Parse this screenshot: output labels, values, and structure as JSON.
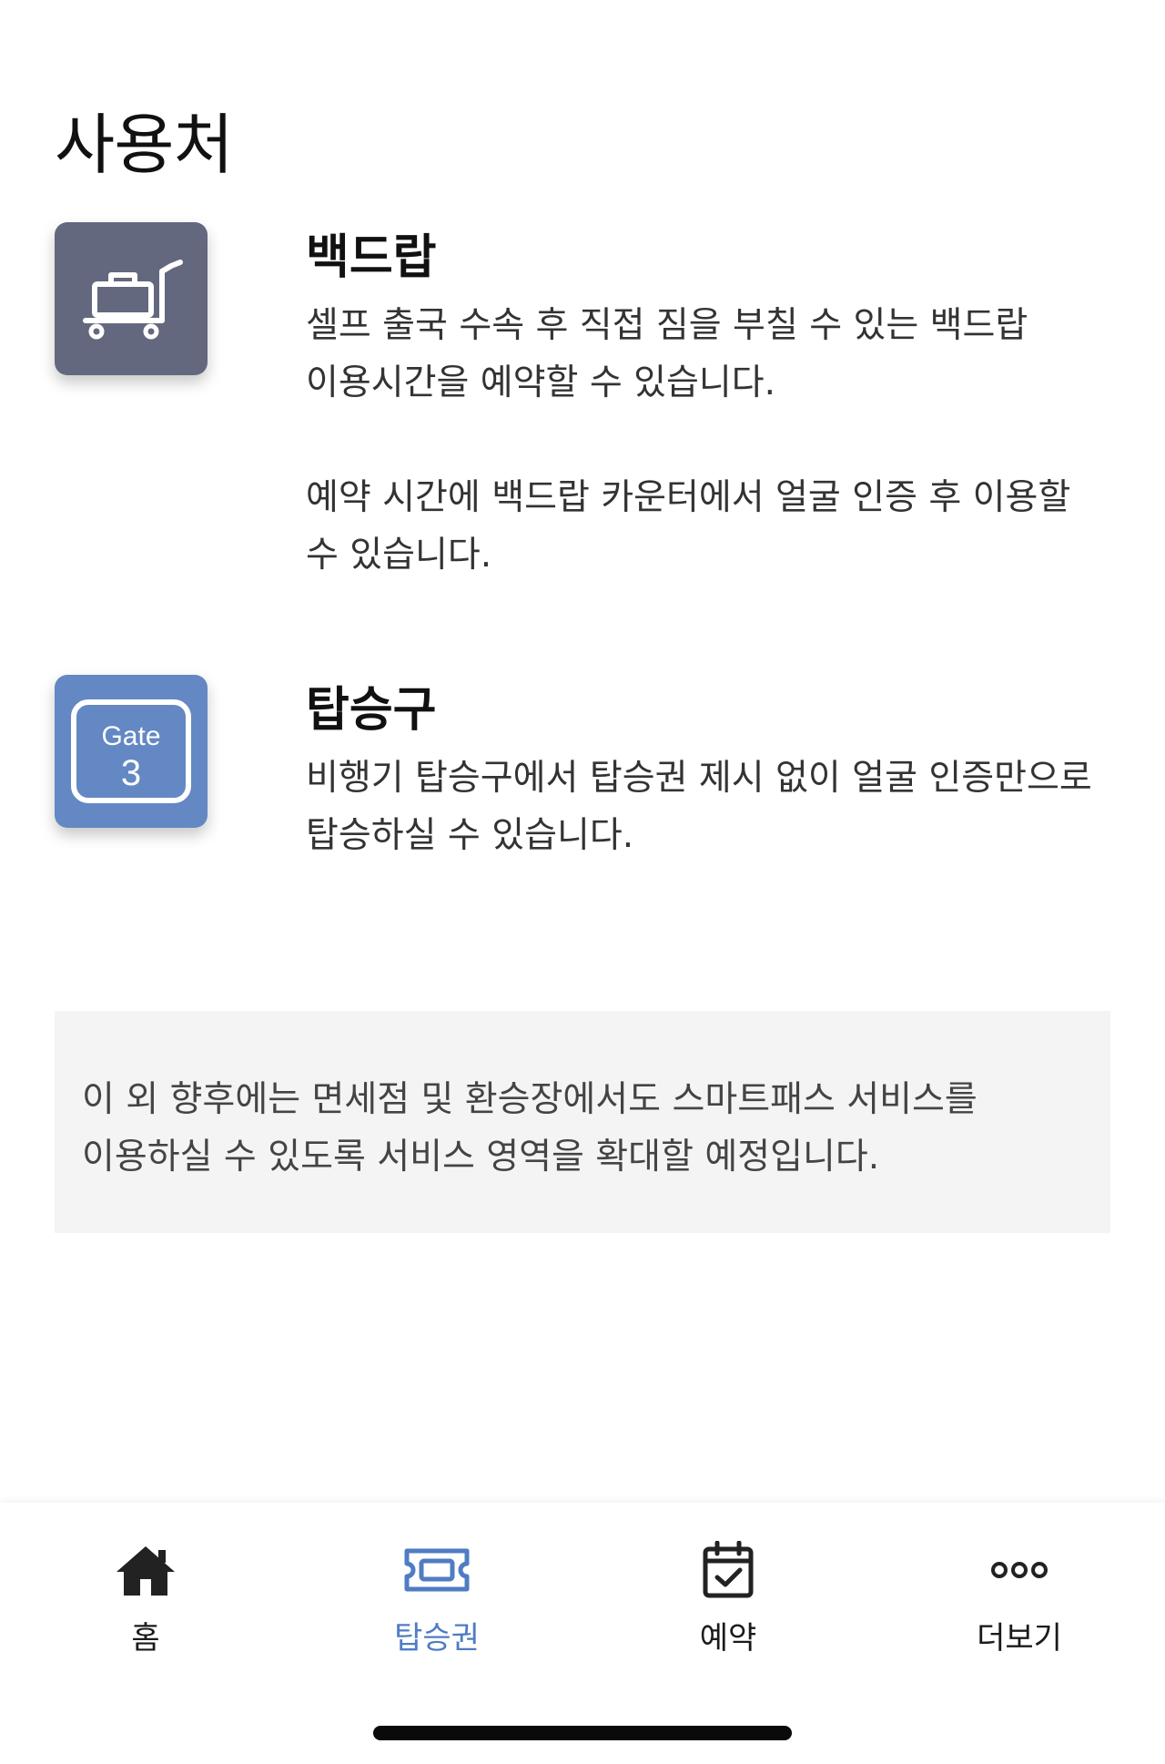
{
  "page": {
    "title": "사용처"
  },
  "services": [
    {
      "icon": "luggage-cart-icon",
      "title": "백드랍",
      "description": "셀프 출국 수속 후 직접 짐을 부칠 수 있는 백드랍 이용시간을 예약할 수 있습니다.\n\n예약 시간에 백드랍 카운터에서 얼굴 인증 후 이용할 수 있습니다."
    },
    {
      "icon": "gate-sign-icon",
      "icon_text_top": "Gate",
      "icon_text_bottom": "3",
      "title": "탑승구",
      "description": "비행기 탑승구에서 탑승권 제시 없이 얼굴 인증만으로 탑승하실 수 있습니다."
    }
  ],
  "notice": {
    "text": "이 외 향후에는 면세점 및 환승장에서도 스마트패스 서비스를 이용하실 수 있도록 서비스 영역을 확대할 예정입니다."
  },
  "bottom_nav": {
    "items": [
      {
        "label": "홈",
        "icon": "home-icon"
      },
      {
        "label": "탑승권",
        "icon": "ticket-icon",
        "active": true
      },
      {
        "label": "예약",
        "icon": "calendar-check-icon"
      },
      {
        "label": "더보기",
        "icon": "more-dots-icon"
      }
    ]
  },
  "colors": {
    "accent": "#4f7cc4",
    "bagdrop_icon_bg": "#63687f",
    "gate_icon_bg": "#6388c3",
    "notice_bg": "#f4f4f4"
  }
}
